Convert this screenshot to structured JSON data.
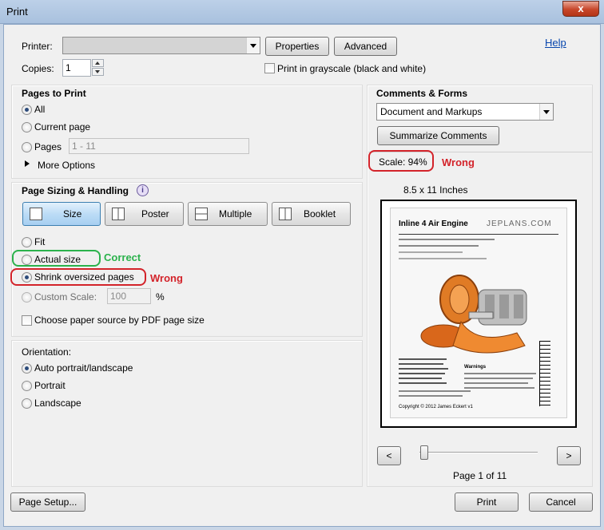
{
  "window": {
    "title": "Print",
    "close_symbol": "x"
  },
  "top": {
    "printer_label": "Printer:",
    "properties_label": "Properties",
    "advanced_label": "Advanced",
    "help_label": "Help",
    "copies_label": "Copies:",
    "copies_value": "1",
    "grayscale_label": "Print in grayscale (black and white)",
    "grayscale_checked": false
  },
  "pages_to_print": {
    "title": "Pages to Print",
    "all_label": "All",
    "current_label": "Current page",
    "pages_label": "Pages",
    "pages_value": "1 - 11",
    "more_options_label": "More Options",
    "selected": "All"
  },
  "sizing": {
    "title": "Page Sizing & Handling",
    "info_icon": "info-icon",
    "buttons": [
      "Size",
      "Poster",
      "Multiple",
      "Booklet"
    ],
    "active_button": "Size",
    "fit_label": "Fit",
    "actual_label": "Actual size",
    "shrink_label": "Shrink oversized pages",
    "custom_label": "Custom Scale:",
    "custom_value": "100",
    "percent": "%",
    "paper_source_label": "Choose paper source by PDF page size",
    "selected": "Shrink oversized pages"
  },
  "orientation": {
    "title": "Orientation:",
    "auto_label": "Auto portrait/landscape",
    "portrait_label": "Portrait",
    "landscape_label": "Landscape",
    "selected": "Auto portrait/landscape"
  },
  "comments": {
    "title": "Comments & Forms",
    "dropdown_value": "Document and Markups",
    "summarize_label": "Summarize Comments"
  },
  "preview": {
    "scale_text": "Scale:  94%",
    "paper_size": "8.5 x 11 Inches",
    "doc_title": "Inline 4 Air Engine",
    "doc_brand": "JEPLANS.COM",
    "doc_warning": "Warnings",
    "doc_copyright": "Copyright © 2012  James Eckert  v1",
    "prev_label": "<",
    "next_label": ">",
    "page_status": "Page 1 of 11"
  },
  "annotations": {
    "correct": "Correct",
    "wrong_shrink": "Wrong",
    "wrong_scale": "Wrong",
    "green": "#2bb24c",
    "red": "#d3232a"
  },
  "footer": {
    "page_setup_label": "Page Setup...",
    "print_label": "Print",
    "cancel_label": "Cancel"
  }
}
